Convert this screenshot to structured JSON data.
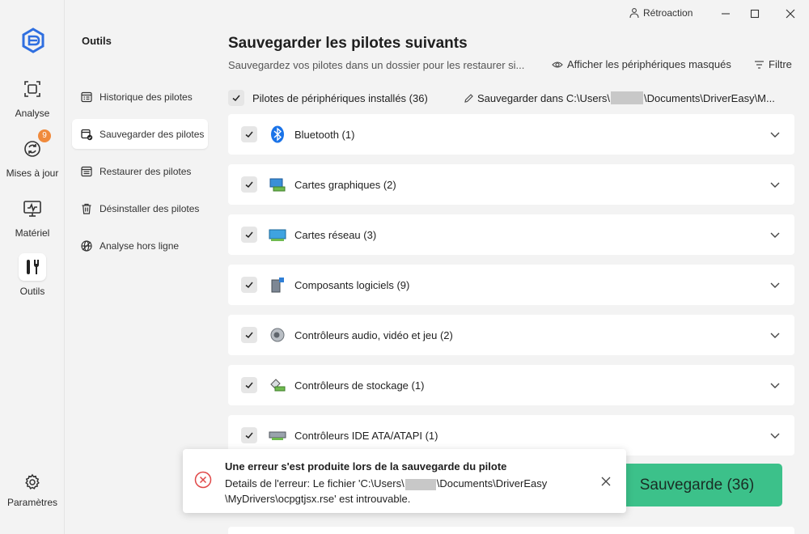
{
  "rail": {
    "items": [
      {
        "label": "Analyse",
        "icon": "scan-icon"
      },
      {
        "label": "Mises à jour",
        "icon": "update-icon",
        "badge": "9"
      },
      {
        "label": "Matériel",
        "icon": "hardware-icon"
      },
      {
        "label": "Outils",
        "icon": "tools-icon"
      }
    ],
    "settings": "Paramètres"
  },
  "subnav": {
    "title": "Outils",
    "items": [
      {
        "label": "Historique des pilotes",
        "icon": "history-icon"
      },
      {
        "label": "Sauvegarder des pilotes",
        "icon": "backup-icon"
      },
      {
        "label": "Restaurer des pilotes",
        "icon": "restore-icon"
      },
      {
        "label": "Désinstaller des pilotes",
        "icon": "trash-icon"
      },
      {
        "label": "Analyse hors ligne",
        "icon": "offline-icon"
      }
    ]
  },
  "titlebar": {
    "feedback": "Rétroaction"
  },
  "main": {
    "title": "Sauvegarder les pilotes suivants",
    "subtitle": "Sauvegardez vos pilotes dans un dossier pour les restaurer si...",
    "show_hidden": "Afficher les périphériques masqués",
    "filter": "Filtre",
    "all_label": "Pilotes de périphériques installés (36)",
    "save_path_prefix": "Sauvegarder dans C:\\Users\\",
    "save_path_suffix": "\\Documents\\DriverEasy\\M...",
    "categories": [
      {
        "label": "Bluetooth (1)",
        "icon": "bluetooth-icon"
      },
      {
        "label": "Cartes graphiques (2)",
        "icon": "graphics-card-icon"
      },
      {
        "label": "Cartes réseau (3)",
        "icon": "network-card-icon"
      },
      {
        "label": "Composants logiciels (9)",
        "icon": "software-component-icon"
      },
      {
        "label": "Contrôleurs audio, vidéo et jeu (2)",
        "icon": "speaker-icon"
      },
      {
        "label": "Contrôleurs de stockage (1)",
        "icon": "storage-controller-icon"
      },
      {
        "label": "Contrôleurs IDE ATA/ATAPI (1)",
        "icon": "ide-controller-icon"
      }
    ],
    "backup_button": "Sauvegarde (36)"
  },
  "toast": {
    "title": "Une erreur s'est produite lors de la sauvegarde du pilote",
    "line1_prefix": "Details de l'erreur: Le fichier 'C:\\Users\\",
    "line1_suffix": "\\Documents\\DriverEasy",
    "line2": "\\MyDrivers\\ocpgtjsx.rse' est introuvable."
  },
  "colors": {
    "accent": "#3cc18a",
    "badge": "#f08a3c",
    "error": "#e04848",
    "brand": "#2f6fe0"
  }
}
